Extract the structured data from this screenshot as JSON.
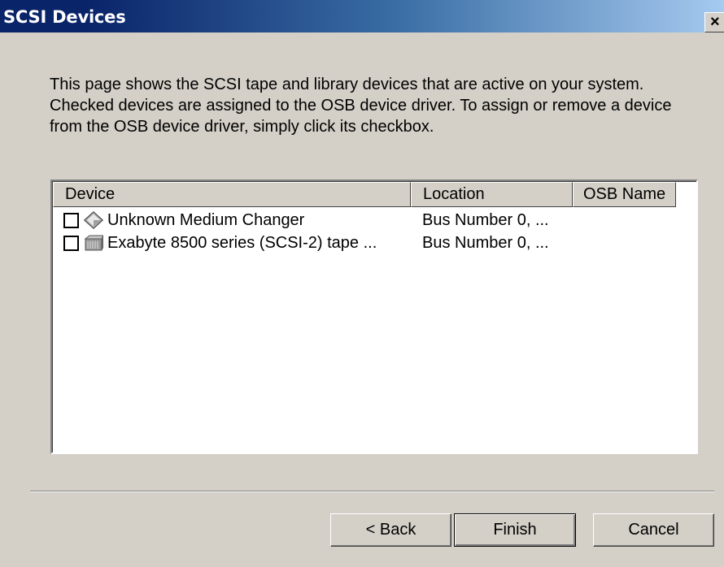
{
  "window": {
    "title": "SCSI Devices",
    "close_label": "×"
  },
  "description": "This page shows the SCSI tape and library devices that are active on your system. Checked devices are assigned to the OSB device driver. To assign or remove a device from the OSB device driver, simply click its checkbox.",
  "device_list": {
    "columns": [
      "Device",
      "Location",
      "OSB Name"
    ],
    "rows": [
      {
        "device": "Unknown Medium Changer",
        "location": "Bus Number 0, ...",
        "osb_name": "",
        "checked": false,
        "icon": "medium-changer-icon"
      },
      {
        "device": "Exabyte 8500 series (SCSI-2) tape ...",
        "location": "Bus Number 0, ...",
        "osb_name": "",
        "checked": false,
        "icon": "tape-drive-icon"
      }
    ]
  },
  "buttons": {
    "back": "< Back",
    "finish": "Finish",
    "cancel": "Cancel"
  },
  "colors": {
    "titlebar_start": "#0a246a",
    "titlebar_end": "#a6caf0",
    "dialog_face": "#d4d0c8"
  }
}
